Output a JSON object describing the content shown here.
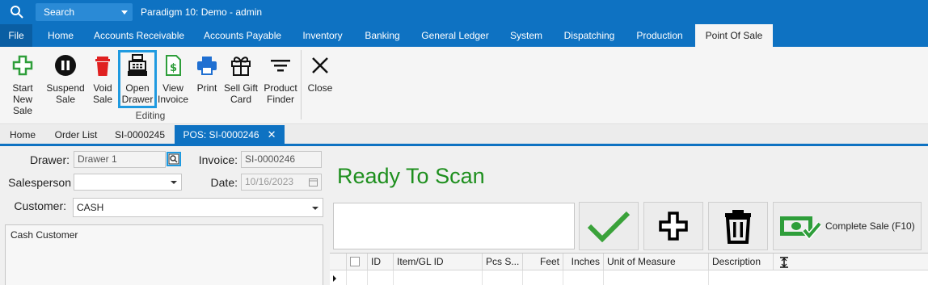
{
  "titlebar": {
    "search_icon": "search-icon",
    "search_label": "Search",
    "app_title": "Paradigm 10: Demo - admin"
  },
  "menu": {
    "file": "File",
    "tabs": [
      "Home",
      "Accounts Receivable",
      "Accounts Payable",
      "Inventory",
      "Banking",
      "General Ledger",
      "System",
      "Dispatching",
      "Production",
      "Point Of Sale"
    ],
    "active": "Point Of Sale"
  },
  "ribbon": {
    "buttons": [
      {
        "label": "Start New Sale",
        "icon": "plus-icon"
      },
      {
        "label": "Suspend Sale",
        "icon": "pause-icon"
      },
      {
        "label": "Void Sale",
        "icon": "trash-icon"
      },
      {
        "label": "Open Drawer",
        "icon": "cash-register-icon"
      },
      {
        "label": "View Invoice",
        "icon": "invoice-icon"
      },
      {
        "label": "Print",
        "icon": "printer-icon"
      },
      {
        "label": "Sell Gift Card",
        "icon": "gift-icon"
      },
      {
        "label": "Product Finder",
        "icon": "filter-icon"
      },
      {
        "label": "Close",
        "icon": "close-icon"
      }
    ],
    "group_label": "Editing"
  },
  "doc_tabs": [
    "Home",
    "Order List",
    "SI-0000245",
    "POS: SI-0000246"
  ],
  "form": {
    "drawer_label": "Drawer:",
    "drawer_value": "Drawer 1",
    "invoice_label": "Invoice:",
    "invoice_value": "SI-0000246",
    "salesperson_label": "Salesperson",
    "salesperson_value": "",
    "date_label": "Date:",
    "date_value": "10/16/2023",
    "customer_label": "Customer:",
    "customer_value": "CASH",
    "customer_name": "Cash Customer"
  },
  "scan": {
    "status": "Ready To Scan",
    "complete_label": "Complete Sale (F10)"
  },
  "grid": {
    "columns": [
      "",
      "ID",
      "Item/GL ID",
      "Pcs S...",
      "Feet",
      "Inches",
      "Unit of Measure",
      "Description"
    ]
  },
  "colors": {
    "brand": "#0e72c2",
    "success": "#1e8f1e",
    "accent": "#1f9ae0"
  }
}
